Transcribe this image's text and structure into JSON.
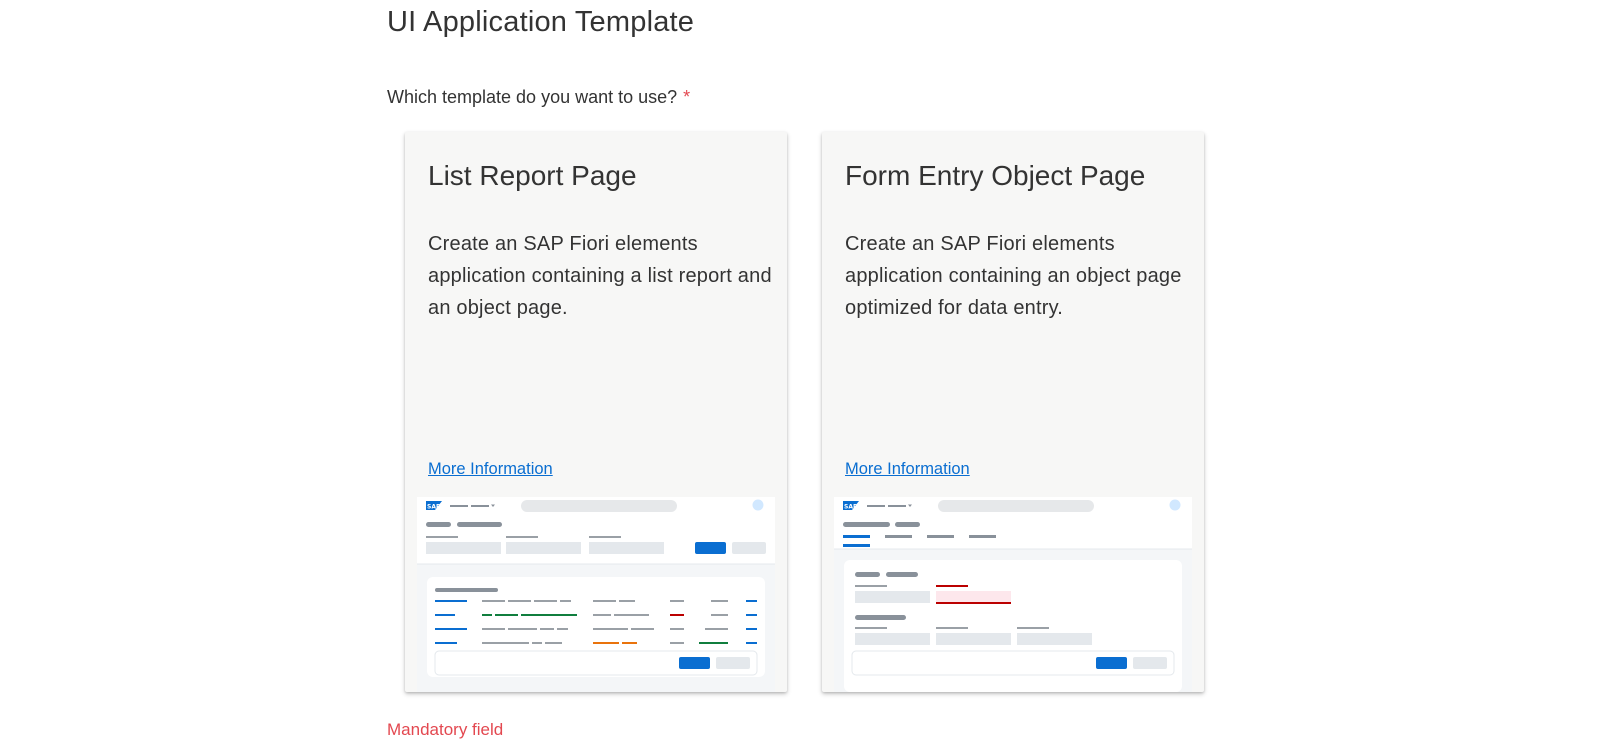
{
  "page": {
    "title": "UI Application Template",
    "question": "Which template do you want to use?",
    "required_marker": "*",
    "mandatory_note": "Mandatory field"
  },
  "templates": [
    {
      "title": "List Report Page",
      "description": "Create an SAP Fiori elements application containing a list report and an object page.",
      "link": "More Information"
    },
    {
      "title": "Form Entry Object Page",
      "description": "Create an SAP Fiori elements application containing an object page optimized for data entry.",
      "link": "More Information"
    }
  ],
  "colors": {
    "accent": "#0a6ed1",
    "error": "#e34850",
    "card_bg": "#f7f7f6"
  },
  "icons": [
    "sap-logo-icon"
  ]
}
